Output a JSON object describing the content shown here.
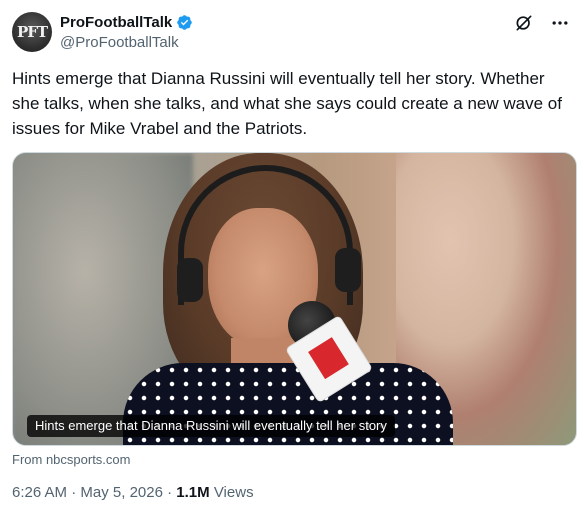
{
  "author": {
    "display_name": "ProFootballTalk",
    "handle": "@ProFootballTalk",
    "avatar_text": "PFT",
    "verified": true
  },
  "tweet": {
    "text": "Hints emerge that Dianna Russini will eventually tell her story. Whether she talks, when she talks, and what she says could create a new wave of issues for Mike Vrabel and the Patriots."
  },
  "media": {
    "caption": "Hints emerge that Dianna Russini will eventually tell her story",
    "source": "From nbcsports.com"
  },
  "meta": {
    "time": "6:26 AM",
    "separator": "·",
    "date": "May 5, 2026",
    "views_count": "1.1M",
    "views_label": "Views"
  },
  "icons": {
    "verified": "verified-badge-icon",
    "grok": "grok-icon",
    "more": "more-icon"
  },
  "colors": {
    "text_primary": "#0f1419",
    "text_secondary": "#536471",
    "verified_blue": "#1d9bf0"
  }
}
